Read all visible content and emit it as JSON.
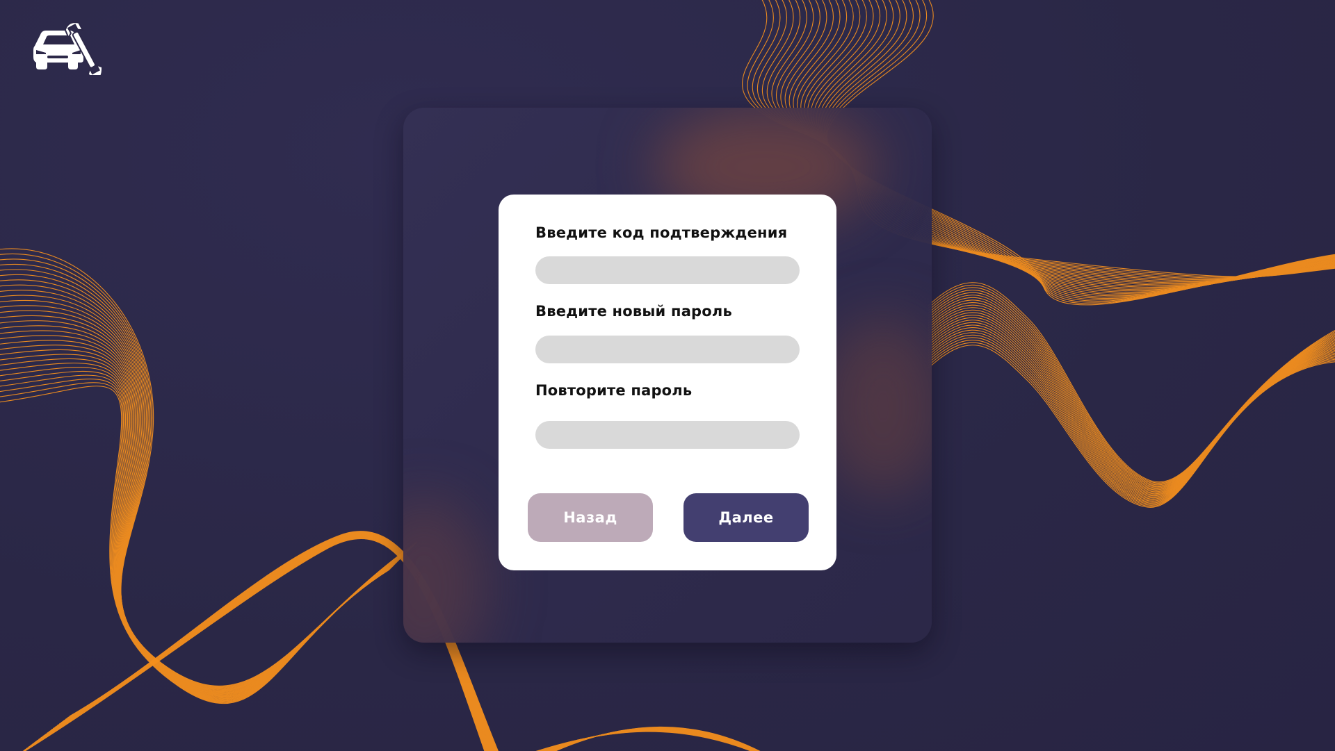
{
  "app": {
    "logo_icon": "car-wrench-icon"
  },
  "colors": {
    "background": "#2c2848",
    "accent_orange": "#f5901e",
    "panel": "#302c52",
    "card": "#ffffff",
    "input_fill": "#d9d9d9",
    "back_button": "#bdaab8",
    "next_button": "#433f70"
  },
  "form": {
    "code_label": "Введите код подтверждения",
    "code_value": "",
    "new_password_label": "Введите  новый  пароль",
    "new_password_value": "",
    "repeat_password_label": "Повторите  пароль",
    "repeat_password_value": "",
    "back_label": "Назад",
    "next_label": "Далее"
  }
}
